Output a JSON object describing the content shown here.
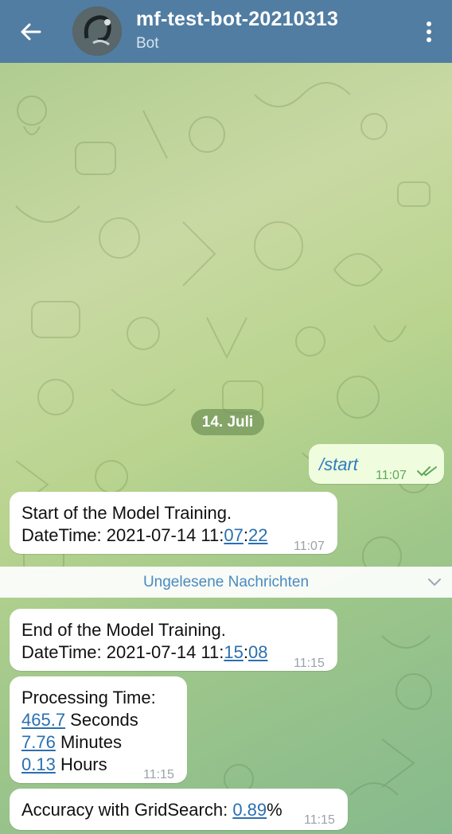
{
  "header": {
    "title": "mf-test-bot-20210313",
    "subtitle": "Bot",
    "colors": {
      "bar": "#517da2"
    }
  },
  "chat": {
    "date_separator": "14. Juli",
    "unread_label": "Ungelesene Nachrichten",
    "messages": [
      {
        "direction": "out",
        "text": "/start",
        "time": "11:07",
        "status": "read-double-check-icon"
      },
      {
        "direction": "in",
        "line1": "Start of the Model Training.",
        "line2_prefix": "DateTime: 2021-07-14 11:",
        "line2_link1": "07",
        "line2_sep": ":",
        "line2_link2": "22",
        "time": "11:07"
      },
      {
        "direction": "in",
        "line1": "End of the Model Training.",
        "line2_prefix": "DateTime: 2021-07-14 11:",
        "line2_link1": "15",
        "line2_sep": ":",
        "line2_link2": "08",
        "time": "11:15"
      },
      {
        "direction": "in",
        "line1": "Processing Time:",
        "seconds_value": "465.7",
        "seconds_unit": " Seconds",
        "minutes_value": "7.76",
        "minutes_unit": " Minutes",
        "hours_value": "0.13",
        "hours_unit": " Hours",
        "time": "11:15"
      },
      {
        "direction": "in",
        "prefix": "Accuracy with GridSearch: ",
        "value": "0.89",
        "suffix": "%",
        "time": "11:15"
      }
    ]
  }
}
